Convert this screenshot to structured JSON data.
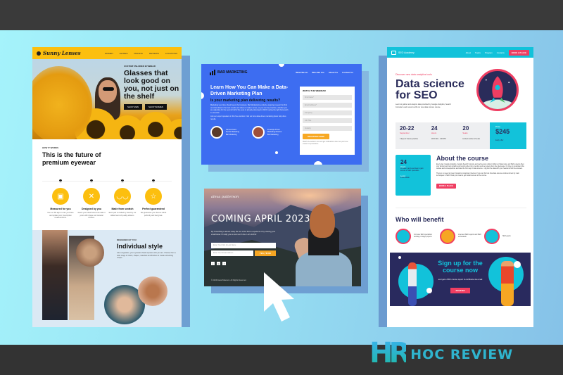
{
  "brand": {
    "logo_mark": "HR",
    "logo_text": "HOC REVIEW",
    "colors": {
      "dark_bar": "#3a3a3a",
      "logo": "#2fb4ce"
    }
  },
  "sunny_lenses": {
    "logo": "Sunny Lenses",
    "nav": [
      "WOMEN",
      "LENSES",
      "PRICING",
      "REVIEWS",
      "LOCATIONS"
    ],
    "hero": {
      "eyebrow": "CUSTOM TAILORED EYEWEAR",
      "title": "Glasses that look good on you, not just on the shelf",
      "buttons": [
        "SHOP MEN",
        "SHOP WOMEN"
      ]
    },
    "how": {
      "eyebrow": "HOW IT WORKS",
      "title": "This is the future of premium eyewear",
      "steps": [
        {
          "title": "Measured for you",
          "desc": "Use our 3D app to scan your face and upload your prescription measurements.",
          "icon": "box-icon"
        },
        {
          "title": "Designed by you",
          "desc": "Select your ideal frame and make it yours with shape and material choices.",
          "icon": "tools-icon"
        },
        {
          "title": "Made from scratch",
          "desc": "Each pair is crafted by hand by our skilled team of quality artisans.",
          "icon": "glasses-icon"
        },
        {
          "title": "Perfect guaranteed",
          "desc": "We guarantee your frames will fit perfectly and feel great.",
          "icon": "star-icon"
        }
      ]
    },
    "individual": {
      "eyebrow": "DESIGNED BY YOU",
      "title": "Individual style",
      "text": "Like a signature, your eyewear should express who you are. Choose from a wide range of colors, shapes, materials and finishes to create something unique."
    },
    "accent": "#fcbf0f"
  },
  "bar_marketing": {
    "logo": "BAR MARKETING",
    "nav": [
      "What We do",
      "Who We Are",
      "About Us",
      "Contact Us"
    ],
    "title": "Learn How You Can Make a Data-Driven Marketing Plan",
    "subtitle": "Is your marketing plan delivering results?",
    "para1": "Marketing your time should serve the business. Bar Marketing's exclusive ongoing research to find out what delivers the best results and where it makes sense, so you can be proactive, whether you are adjusting for the second half of the year or already planning for 2023, having the right framework is essential.",
    "para2": "Join our expert speakers in this free webinar. Find out how data-driven marketing plans help drive results.",
    "speakers": [
      {
        "name": "James Evans",
        "role": "Senior Marketing",
        "company": "Bar Marketing"
      },
      {
        "name": "Penelope Perez",
        "role": "Marketing Director",
        "company": "Bar Marketing"
      }
    ],
    "form": {
      "title": "WATCH THE WEBINAR",
      "fields": [
        "First Name*",
        "Email Address*",
        "Company",
        "Job Title",
        "Industry"
      ],
      "button": "REGISTER NOW",
      "note": "Watch the webinar now and get notifications when we post new content or promotions."
    },
    "accent": "#3d6df1",
    "button_color": "#f7a823"
  },
  "coming_soon": {
    "logo": "alexa patterson",
    "title": "COMING APRIL 2023",
    "text": "My Travel Blog is almost ready. Be one of the first to experience it by entering your email below. I'll notify you as soon as it's live. Let's do this!",
    "name_placeholder": "Enter Your First & Last Name",
    "email_placeholder": "Enter Your Email Address",
    "button": "YES, I'M IN!",
    "social": [
      "twitter-icon",
      "instagram-icon",
      "facebook-icon"
    ],
    "footer": "© 2023 Alexa Patterson. All Rights Reserved."
  },
  "seo_academy": {
    "logo": "SEO Academy",
    "nav": [
      "About",
      "Topics",
      "Program",
      "Contacts"
    ],
    "nav_button": "BOOK A PLACE",
    "eyebrow": "Discover new data analytics tools",
    "title": "Data science for SEO",
    "intro": "Learn to gather and analyze data provided by Google Analytics, Search Console & web servers with our new data science course.",
    "stats": [
      {
        "value": "20-22",
        "label": "September",
        "desc": "3 days of intense practice"
      },
      {
        "value": "24",
        "label": "Hours",
        "desc": "10:00 AM – 4:00 PM"
      },
      {
        "value": "20",
        "label": "Seats",
        "desc": "Limited number of seats"
      }
    ],
    "price": {
      "label": "Price",
      "value": "$245",
      "desc": "Early offer"
    },
    "about": {
      "box": {
        "value": "24",
        "label": "Hours",
        "desc": "of reading and exercises to gain access to SEO specialists",
        "label2": "Level",
        "value2": "Intermediate"
      },
      "title": "About the course",
      "para1": "Every day, Google Analytics, Google Search Console and web servers collect millions of data rows, and SEO experts often only look at summary graphs and reports when they mention and get upset when they decrease. It's time to understand the causes and consequences and take the first step in data science – dig into the data with your head and find the answers.",
      "para2": "There is no need to invent Google's conspiracy theories if you can find out how data science works and test by main techniques in SEO. Book your seat to get instant access to the course.",
      "button": "BOOK A PLACE"
    },
    "benefit": {
      "title": "Who will benefit",
      "items": [
        "In-house SEO specialists working on large projects",
        "Licensed SEO experts and SEO enthusiasts",
        "SEO geeks"
      ]
    },
    "signup": {
      "title": "Sign up for the course now",
      "text": "and get a PDF course report & certificate via email",
      "button": "REGISTER"
    },
    "colors": {
      "primary": "#12c2da",
      "accent": "#ef3e62",
      "dark": "#2a2c5a"
    }
  }
}
